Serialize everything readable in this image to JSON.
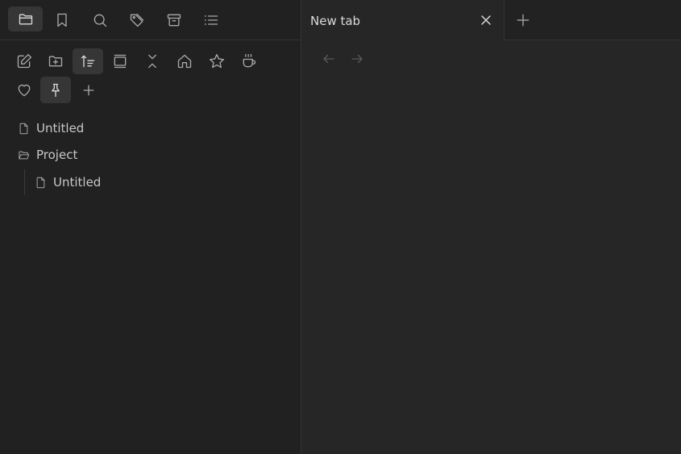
{
  "sidebar": {
    "tabs": [
      {
        "icon": "folder-icon",
        "active": true
      },
      {
        "icon": "bookmark-icon"
      },
      {
        "icon": "search-icon"
      },
      {
        "icon": "tags-icon"
      },
      {
        "icon": "archive-icon"
      },
      {
        "icon": "list-icon"
      }
    ],
    "toolbar": [
      {
        "icon": "new-note-icon"
      },
      {
        "icon": "new-folder-icon"
      },
      {
        "icon": "sort-icon",
        "active": true
      },
      {
        "icon": "auto-reveal-icon"
      },
      {
        "icon": "collapse-all-icon"
      },
      {
        "icon": "home-icon"
      },
      {
        "icon": "star-icon"
      },
      {
        "icon": "coffee-icon"
      },
      {
        "icon": "heart-icon"
      },
      {
        "icon": "pin-icon",
        "active": true
      },
      {
        "icon": "plus-icon"
      }
    ],
    "tree": [
      {
        "label": "Untitled",
        "type": "file"
      },
      {
        "label": "Project",
        "type": "folder"
      },
      {
        "label": "Untitled",
        "type": "file"
      }
    ]
  },
  "main": {
    "tab_title": "New tab"
  },
  "colors": {
    "sidebar_bg": "#212121",
    "main_bg": "#262626",
    "active_btn": "#363636"
  }
}
